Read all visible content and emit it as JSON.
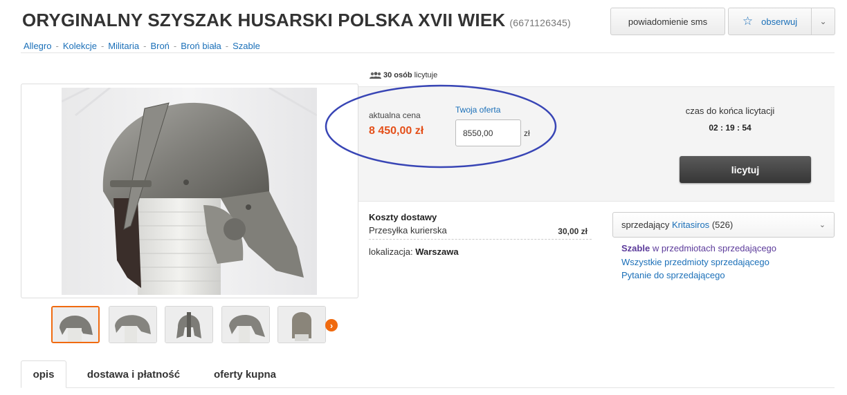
{
  "header": {
    "title": "ORYGINALNY SZYSZAK HUSARSKI POLSKA XVII WIEK",
    "offer_id": "(6671126345)",
    "sms_button": "powiadomienie sms",
    "watch_button": "obserwuj"
  },
  "breadcrumbs": [
    "Allegro",
    "Kolekcje",
    "Militaria",
    "Broń",
    "Broń biała",
    "Szable"
  ],
  "breadcrumb_separator": "-",
  "bidders": {
    "count": "30 osób",
    "suffix": "licytuje"
  },
  "bid": {
    "price_label": "aktualna cena",
    "price_value": "8 450,00 zł",
    "offer_label": "Twoja oferta",
    "offer_value": "8550,00",
    "currency": "zł",
    "time_label": "czas do końca licytacji",
    "time_value": "02 : 19 : 54",
    "bid_button": "licytuj"
  },
  "shipping": {
    "heading": "Koszty dostawy",
    "method": "Przesyłka kurierska",
    "price": "30,00 zł",
    "location_label": "lokalizacja:",
    "location_value": "Warszawa"
  },
  "seller": {
    "label": "sprzedający",
    "name": "Kritasiros",
    "rating": "(526)",
    "link1_bold": "Szable",
    "link1_rest": "w przedmiotach sprzedającego",
    "link2": "Wszystkie przedmioty sprzedającego",
    "link3": "Pytanie do sprzedającego"
  },
  "tabs": [
    "opis",
    "dostawa i płatność",
    "oferty kupna"
  ],
  "colors": {
    "accent": "#f06a0f",
    "price": "#e4501a",
    "link": "#1a6fb8",
    "annotation": "#3845b5"
  }
}
